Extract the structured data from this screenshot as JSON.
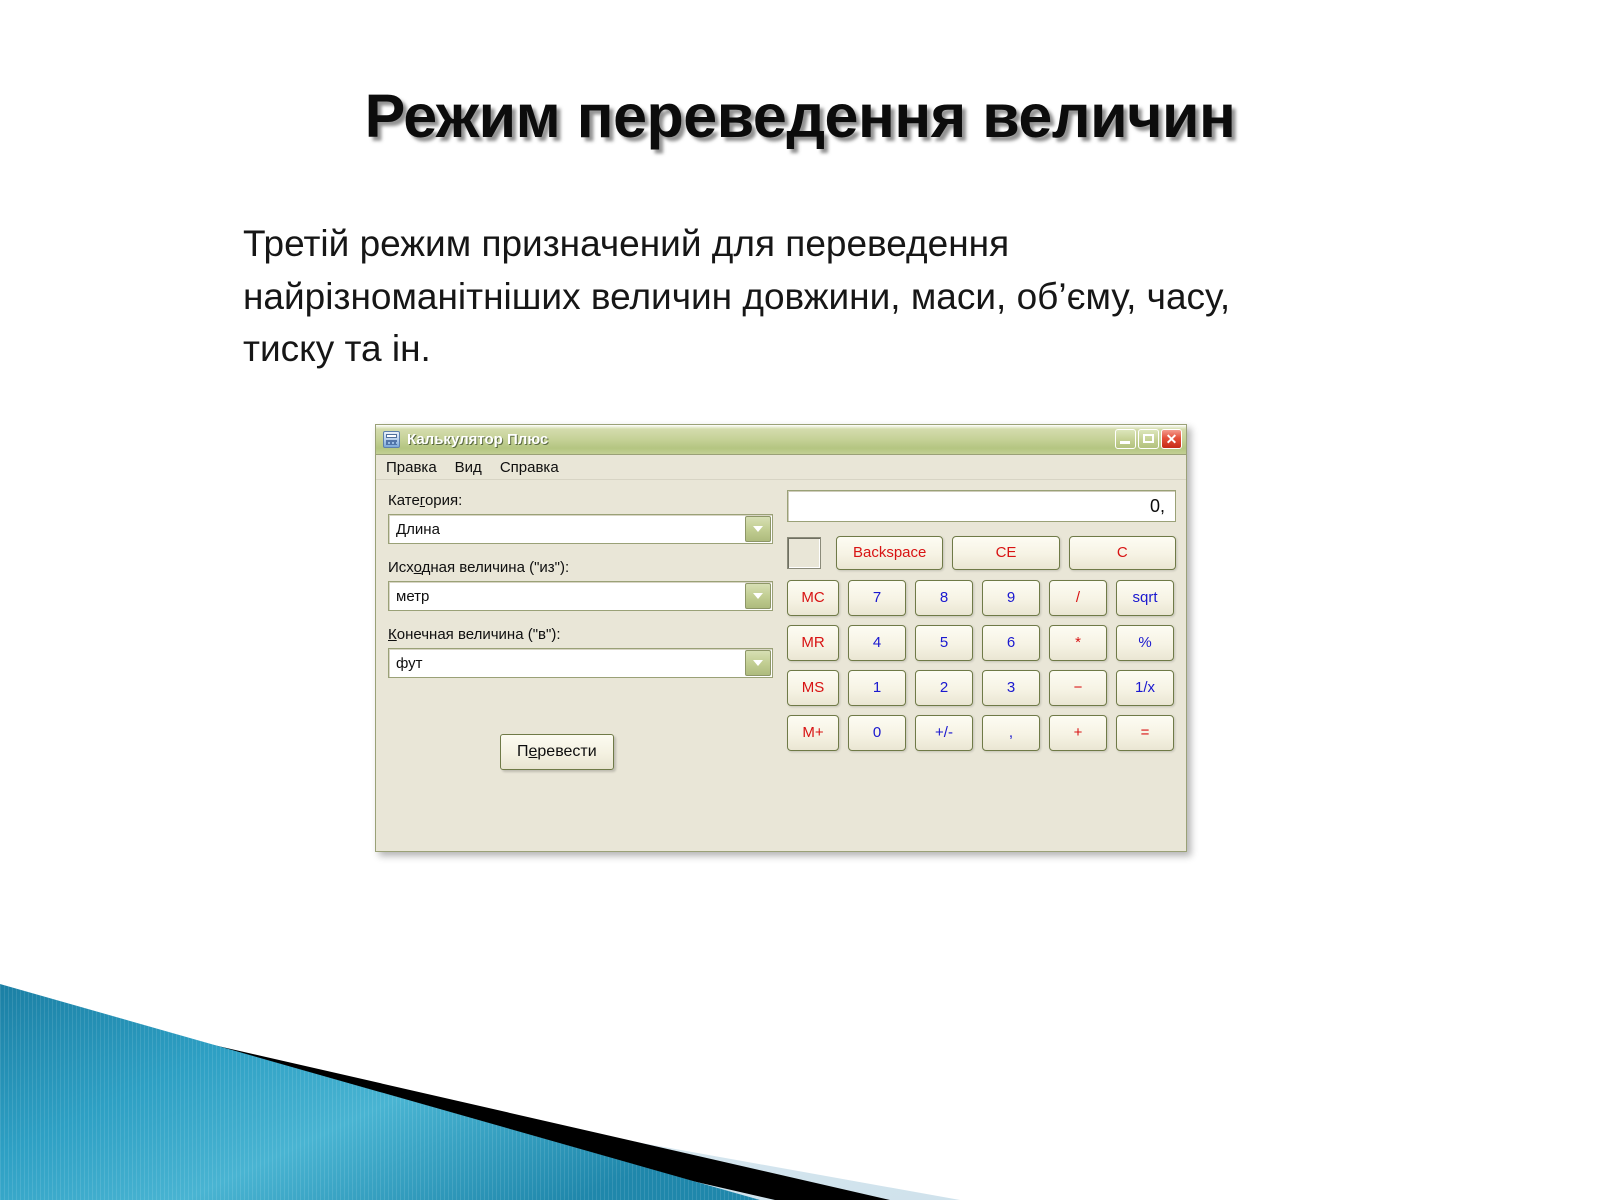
{
  "slide": {
    "title": "Режим переведення величин",
    "body": "Третій режим призначений для переведення найрізноманітніших величин довжини, маси, об’єму, часу, тиску та ін."
  },
  "calculator": {
    "window_title": "Калькулятор Плюс",
    "app_icon": "calculator-icon",
    "window_buttons": {
      "minimize": "minimize-icon",
      "maximize": "maximize-icon",
      "close": "✕"
    },
    "menu": [
      "Правка",
      "Вид",
      "Справка"
    ],
    "converter": {
      "category_label_pre": "Кате",
      "category_label_key": "г",
      "category_label_post": "ория:",
      "category_value": "Длина",
      "from_label_pre": "Исх",
      "from_label_key": "о",
      "from_label_post": "дная величина (\"из\"):",
      "from_value": "метр",
      "to_label_key": "К",
      "to_label_post": "онечная величина (\"в\"):",
      "to_value": "фут",
      "convert_button_pre": "П",
      "convert_button_key": "е",
      "convert_button_post": "ревести",
      "dropdown_icon": "chevron-down-icon"
    },
    "display": {
      "value": "0,"
    },
    "top_buttons": [
      {
        "label": "Backspace",
        "color": "red"
      },
      {
        "label": "CE",
        "color": "red"
      },
      {
        "label": "C",
        "color": "red"
      }
    ],
    "keys": [
      {
        "label": "MC",
        "color": "red"
      },
      {
        "label": "7",
        "color": "blue"
      },
      {
        "label": "8",
        "color": "blue"
      },
      {
        "label": "9",
        "color": "blue"
      },
      {
        "label": "/",
        "color": "red"
      },
      {
        "label": "sqrt",
        "color": "blue"
      },
      {
        "label": "MR",
        "color": "red"
      },
      {
        "label": "4",
        "color": "blue"
      },
      {
        "label": "5",
        "color": "blue"
      },
      {
        "label": "6",
        "color": "blue"
      },
      {
        "label": "*",
        "color": "red"
      },
      {
        "label": "%",
        "color": "blue"
      },
      {
        "label": "MS",
        "color": "red"
      },
      {
        "label": "1",
        "color": "blue"
      },
      {
        "label": "2",
        "color": "blue"
      },
      {
        "label": "3",
        "color": "blue"
      },
      {
        "label": "−",
        "color": "red"
      },
      {
        "label": "1/x",
        "color": "blue"
      },
      {
        "label": "M+",
        "color": "red"
      },
      {
        "label": "0",
        "color": "blue"
      },
      {
        "label": "+/-",
        "color": "blue"
      },
      {
        "label": ",",
        "color": "blue"
      },
      {
        "label": "+",
        "color": "red"
      },
      {
        "label": "=",
        "color": "red"
      }
    ]
  },
  "theme": {
    "title_text": "#0c0c0c",
    "window_bg": "#e9e6d7",
    "titlebar_green": "#c6d298",
    "button_border": "#6f7a47",
    "key_red": "#d81313",
    "key_blue": "#1a18cf",
    "deco_teal": "#2f9cc0",
    "deco_black": "#000000",
    "deco_pale": "#dce9f0"
  }
}
